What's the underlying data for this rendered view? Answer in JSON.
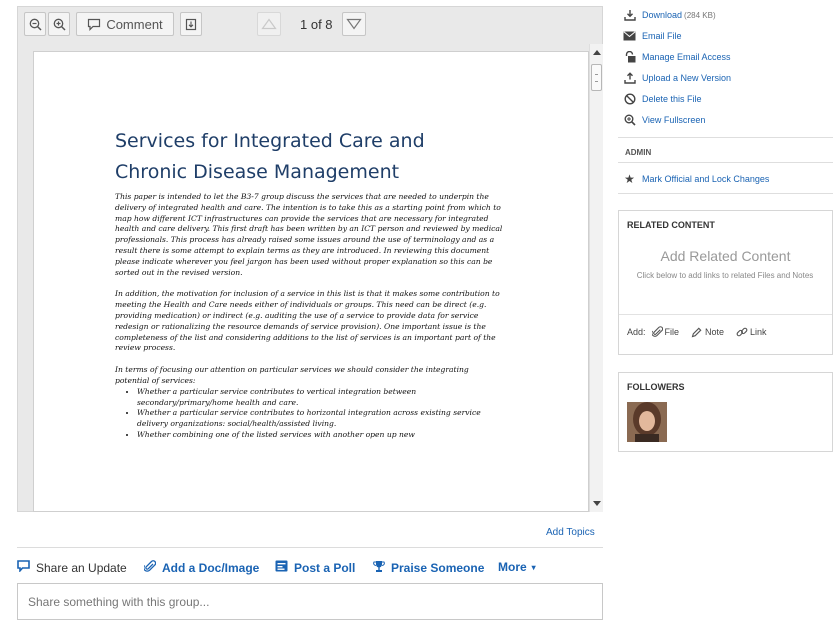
{
  "viewer": {
    "comment_label": "Comment",
    "page_counter": "1 of 8",
    "icons": [
      "zoom-out-icon",
      "zoom-in-icon",
      "comment-icon",
      "download-doc-icon",
      "prev-page-icon",
      "next-page-icon"
    ]
  },
  "document": {
    "title_line1": "Services for Integrated Care and",
    "title_line2": "Chronic Disease Management",
    "para1": "This paper is intended to let the B3-7 group discuss the services that are needed to underpin the delivery of integrated health and care.  The intention is to take this as a starting point from which to map how different ICT infrastructures can provide the services that are necessary for integrated health and care delivery.  This first draft has been written by an ICT person and reviewed by medical professionals. This process has already raised some issues around the use of terminology and as a result there is some attempt to explain terms as they are introduced.  In reviewing this document please indicate wherever you feel jargon has been used without proper explanation so this can be sorted out in the revised version.",
    "para2": "In addition, the motivation for inclusion of a service in this list is that it makes some contribution to meeting the Health and Care needs either of individuals or groups. This need can be direct (e.g. providing medication) or indirect (e.g. auditing the use of a service to provide data for service redesign or rationalizing the resource demands of service provision).  One important issue is the completeness of the list and considering additions to the list of services is an important part of the review process.",
    "para3": "In terms of focusing our attention on particular services we should consider the integrating potential of services:",
    "bullets": [
      "Whether a particular service contributes to vertical integration between secondary/primary/home health and care.",
      "Whether a particular service contributes to horizontal integration across existing service delivery organizations: social/health/assisted living.",
      "Whether combining one of the listed services with another open up new"
    ]
  },
  "add_topics": "Add Topics",
  "share": {
    "items": [
      "Share an Update",
      "Add a Doc/Image",
      "Post a Poll",
      "Praise Someone",
      "More"
    ],
    "placeholder": "Share something with this group..."
  },
  "actions": {
    "download": "Download",
    "download_size": "(284 KB)",
    "email_file": "Email File",
    "manage_email": "Manage Email Access",
    "upload_version": "Upload a New Version",
    "delete_file": "Delete this File",
    "view_fullscreen": "View Fullscreen",
    "admin_label": "ADMIN",
    "mark_official": "Mark Official and Lock Changes"
  },
  "related": {
    "header": "RELATED CONTENT",
    "title": "Add Related Content",
    "subtitle": "Click below to add links to related Files and Notes",
    "add_label": "Add:",
    "file": "File",
    "note": "Note",
    "link": "Link"
  },
  "followers": {
    "header": "FOLLOWERS"
  },
  "colors": {
    "link": "#1a63b3",
    "doc_title": "#1f3e68"
  }
}
